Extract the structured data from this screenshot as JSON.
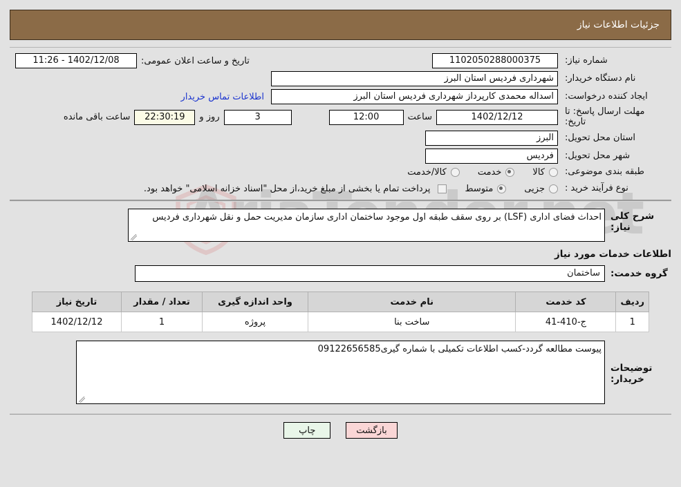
{
  "header": {
    "title": "جزئیات اطلاعات نیاز"
  },
  "form": {
    "need_number_label": "شماره نیاز:",
    "need_number_value": "1102050288000375",
    "public_announce_label": "تاریخ و ساعت اعلان عمومی:",
    "public_announce_value": "1402/12/08 - 11:26",
    "buyer_org_label": "نام دستگاه خریدار:",
    "buyer_org_value": "شهرداری فردیس استان البرز",
    "creator_label": "ایجاد کننده درخواست:",
    "creator_value": "اسداله محمدی کارپرداز شهرداری فردیس استان البرز",
    "contact_link": "اطلاعات تماس خریدار",
    "deadline_label": "مهلت ارسال پاسخ: تا تاریخ:",
    "deadline_date": "1402/12/12",
    "hour_label": "ساعت",
    "deadline_time": "12:00",
    "days_value": "3",
    "days_label": "روز و",
    "countdown_value": "22:30:19",
    "countdown_label": "ساعت باقی مانده",
    "province_label": "استان محل تحویل:",
    "province_value": "البرز",
    "city_label": "شهر محل تحویل:",
    "city_value": "فردیس",
    "classification_label": "طبقه بندی موضوعی:",
    "classification_options": [
      {
        "label": "کالا",
        "selected": false
      },
      {
        "label": "خدمت",
        "selected": true
      },
      {
        "label": "کالا/خدمت",
        "selected": false
      }
    ],
    "process_label": "نوع فرآیند خرید :",
    "process_options": [
      {
        "label": "جزیی",
        "selected": false
      },
      {
        "label": "متوسط",
        "selected": true
      }
    ],
    "treasury_note": "پرداخت تمام یا بخشی از مبلغ خرید،از محل \"اسناد خزانه اسلامی\" خواهد بود."
  },
  "description": {
    "label": "شرح کلی نیاز:",
    "value": "احداث فضای اداری (LSF) بر روی سقف طبقه اول موجود ساختمان اداری سازمان مدیریت حمل و نقل شهرداری فردیس"
  },
  "services": {
    "section_title": "اطلاعات خدمات مورد نیاز",
    "group_label": "گروه خدمت:",
    "group_value": "ساختمان",
    "columns": [
      "ردیف",
      "کد خدمت",
      "نام خدمت",
      "واحد اندازه گیری",
      "تعداد / مقدار",
      "تاریخ نیاز"
    ],
    "rows": [
      {
        "index": "1",
        "code": "ج-410-41",
        "name": "ساخت بنا",
        "unit": "پروژه",
        "quantity": "1",
        "date": "1402/12/12"
      }
    ]
  },
  "comments": {
    "label": "توضیحات خریدار:",
    "value": "پیوست مطالعه گردد-کسب اطلاعات تکمیلی با شماره گیری09122656585"
  },
  "footer": {
    "print_label": "چاپ",
    "back_label": "بازگشت"
  },
  "watermark": {
    "text": "AriaTender.net"
  },
  "colors": {
    "header_bg": "#8b6b47",
    "link": "#1b34cf",
    "countdown_bg": "#fbfbe6",
    "print_btn": "#e9f6e9",
    "back_btn": "#fad6d6"
  }
}
